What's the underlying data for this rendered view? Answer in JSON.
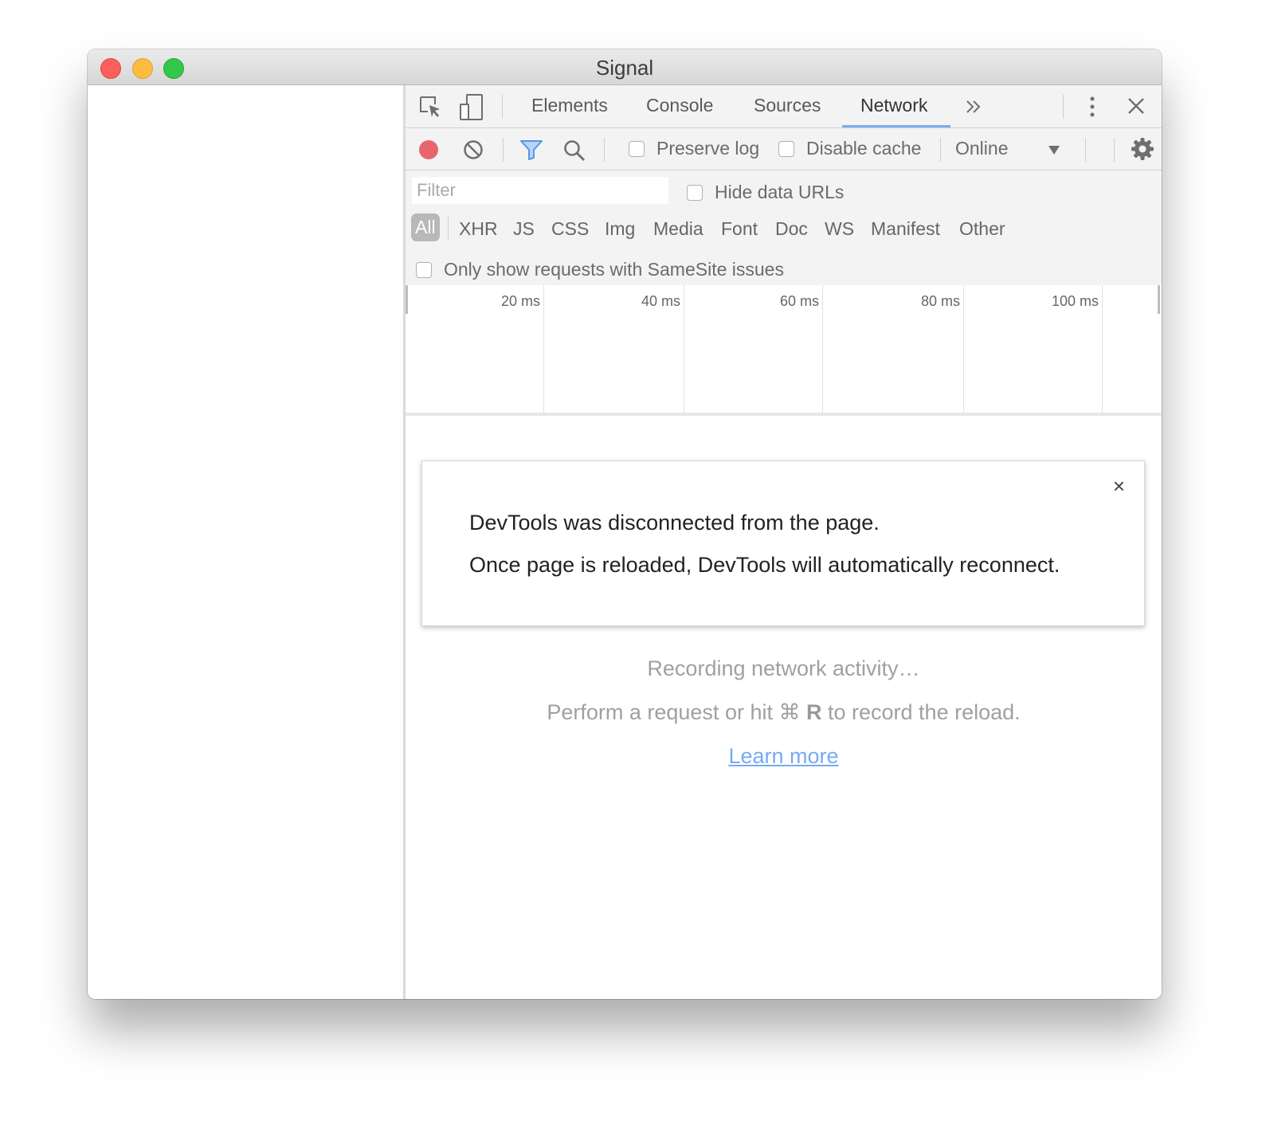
{
  "window": {
    "title": "Signal"
  },
  "devtools": {
    "tabs": [
      {
        "label": "Elements"
      },
      {
        "label": "Console"
      },
      {
        "label": "Sources"
      },
      {
        "label": "Network"
      }
    ],
    "active_tab": "Network",
    "toolbar": {
      "preserve_log": "Preserve log",
      "disable_cache": "Disable cache",
      "throttling": "Online"
    },
    "filter": {
      "placeholder": "Filter",
      "hide_data_urls": "Hide data URLs",
      "types": [
        "All",
        "XHR",
        "JS",
        "CSS",
        "Img",
        "Media",
        "Font",
        "Doc",
        "WS",
        "Manifest",
        "Other"
      ],
      "active_type": "All",
      "samesite": "Only show requests with SameSite issues"
    },
    "timeline": {
      "ticks": [
        "20 ms",
        "40 ms",
        "60 ms",
        "80 ms",
        "100 ms"
      ]
    },
    "dialog": {
      "line1": "DevTools was disconnected from the page.",
      "line2": "Once page is reloaded, DevTools will automatically reconnect.",
      "close": "×"
    },
    "empty": {
      "recording": "Recording network activity…",
      "hint_before": "Perform a request or hit ⌘",
      "hint_key": "R",
      "hint_after": "to record the reload.",
      "learn_more": "Learn more"
    }
  },
  "colors": {
    "accent": "#1a73e8",
    "record": "#e8656b",
    "close_red": "#fc605b",
    "minimize_yellow": "#fdbc40",
    "zoom_green": "#34c84a"
  }
}
